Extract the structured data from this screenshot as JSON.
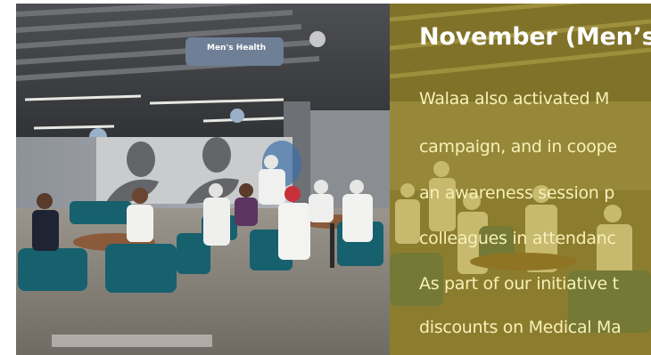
{
  "photo": {
    "banner_text": "Men's Health"
  },
  "panel": {
    "title": "November (Men’s",
    "lines": [
      "Walaa  also  activated  M",
      "campaign, and in coope",
      "an awareness session p",
      "colleagues  in  attendanc",
      "As part of our initiative t",
      "discounts on Medical Ma"
    ]
  },
  "colors": {
    "panel_tint": "#b9a023",
    "title": "#ffffff",
    "body_text": "#f7f0b8"
  }
}
